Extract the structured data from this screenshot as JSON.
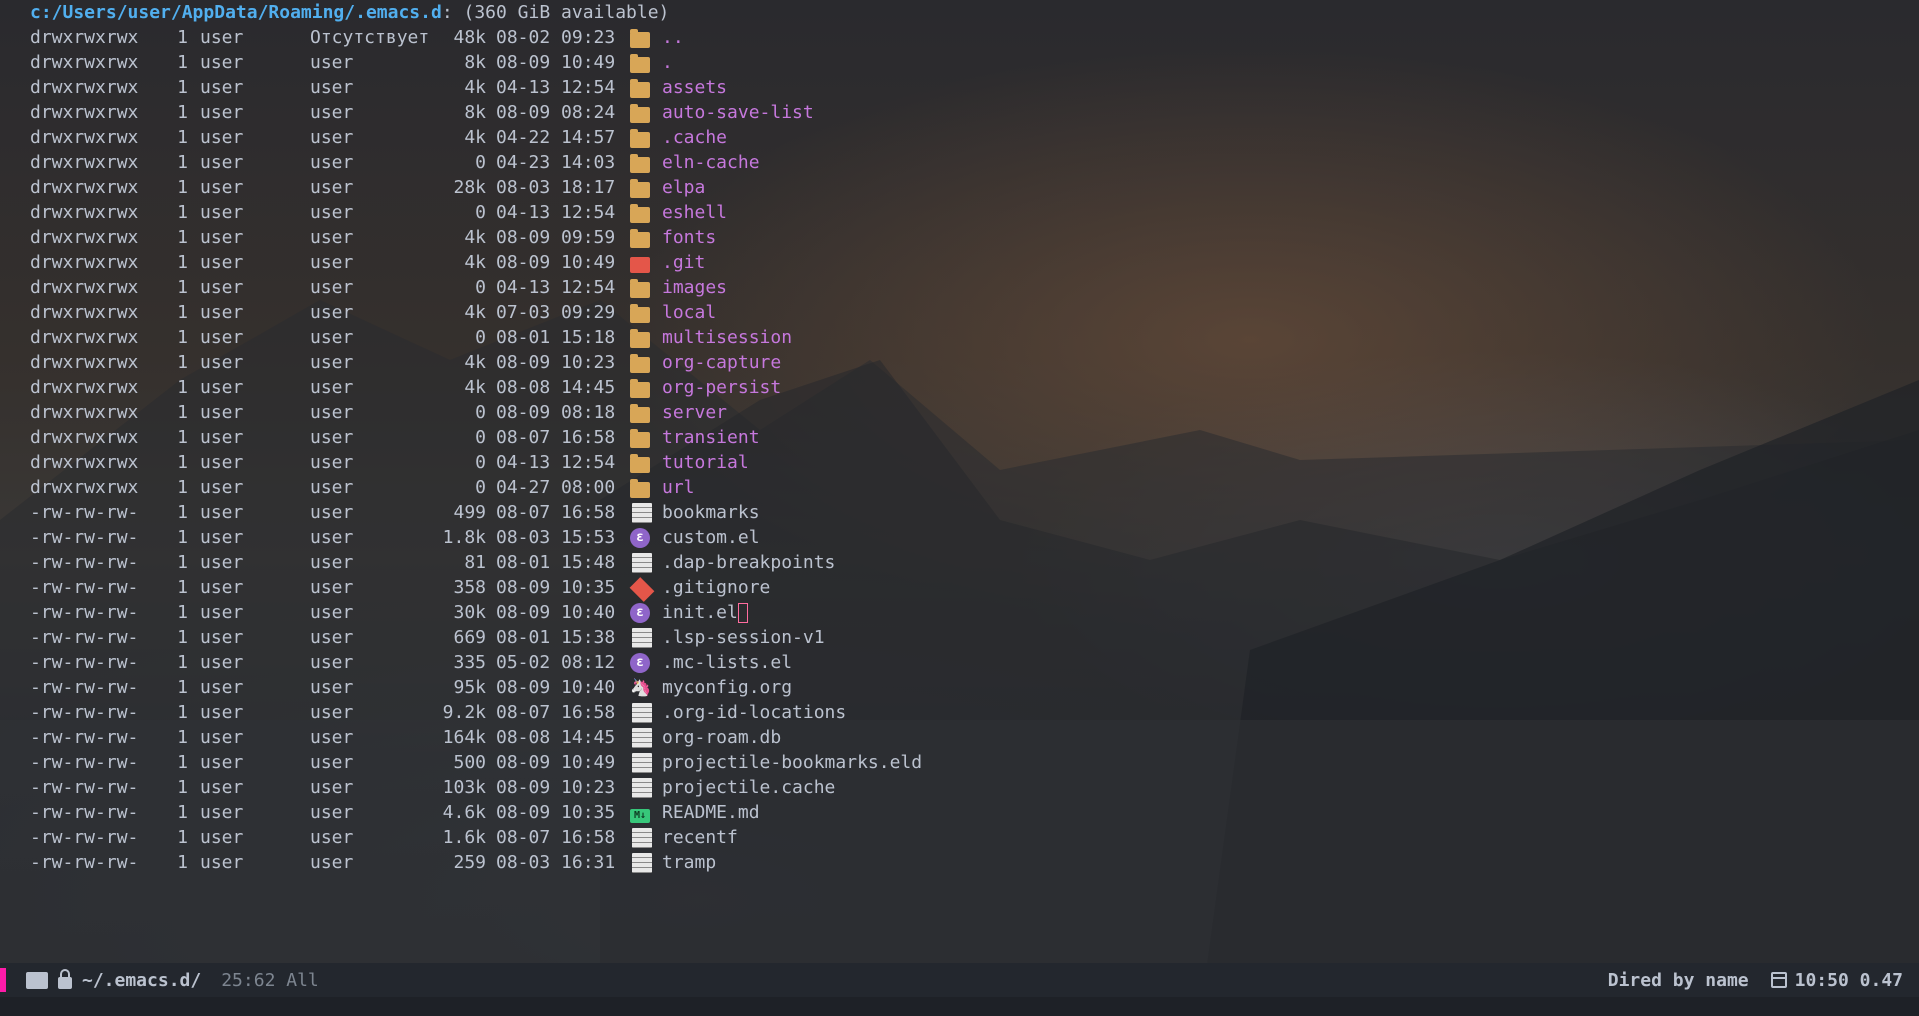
{
  "header": {
    "path": "c:/Users/user/AppData/Roaming/.emacs.d",
    "suffix": ": (360 GiB available)"
  },
  "rows": [
    {
      "perm": "drwxrwxrwx",
      "links": "1",
      "owner": "user",
      "group": "Отсутствует",
      "size": "48k",
      "date": "08-02 09:23",
      "icon": "folder-icon",
      "name": "..",
      "dir": true
    },
    {
      "perm": "drwxrwxrwx",
      "links": "1",
      "owner": "user",
      "group": "user",
      "size": "8k",
      "date": "08-09 10:49",
      "icon": "folder-icon",
      "name": ".",
      "dir": true
    },
    {
      "perm": "drwxrwxrwx",
      "links": "1",
      "owner": "user",
      "group": "user",
      "size": "4k",
      "date": "04-13 12:54",
      "icon": "folder-icon",
      "name": "assets",
      "dir": true
    },
    {
      "perm": "drwxrwxrwx",
      "links": "1",
      "owner": "user",
      "group": "user",
      "size": "8k",
      "date": "08-09 08:24",
      "icon": "folder-icon",
      "name": "auto-save-list",
      "dir": true
    },
    {
      "perm": "drwxrwxrwx",
      "links": "1",
      "owner": "user",
      "group": "user",
      "size": "4k",
      "date": "04-22 14:57",
      "icon": "folder-icon",
      "name": ".cache",
      "dir": true
    },
    {
      "perm": "drwxrwxrwx",
      "links": "1",
      "owner": "user",
      "group": "user",
      "size": "0",
      "date": "04-23 14:03",
      "icon": "folder-icon",
      "name": "eln-cache",
      "dir": true
    },
    {
      "perm": "drwxrwxrwx",
      "links": "1",
      "owner": "user",
      "group": "user",
      "size": "28k",
      "date": "08-03 18:17",
      "icon": "folder-icon",
      "name": "elpa",
      "dir": true
    },
    {
      "perm": "drwxrwxrwx",
      "links": "1",
      "owner": "user",
      "group": "user",
      "size": "0",
      "date": "04-13 12:54",
      "icon": "folder-icon",
      "name": "eshell",
      "dir": true
    },
    {
      "perm": "drwxrwxrwx",
      "links": "1",
      "owner": "user",
      "group": "user",
      "size": "4k",
      "date": "08-09 09:59",
      "icon": "folder-icon",
      "name": "fonts",
      "dir": true
    },
    {
      "perm": "drwxrwxrwx",
      "links": "1",
      "owner": "user",
      "group": "user",
      "size": "4k",
      "date": "08-09 10:49",
      "icon": "git-folder-icon",
      "name": ".git",
      "dir": true
    },
    {
      "perm": "drwxrwxrwx",
      "links": "1",
      "owner": "user",
      "group": "user",
      "size": "0",
      "date": "04-13 12:54",
      "icon": "folder-icon",
      "name": "images",
      "dir": true
    },
    {
      "perm": "drwxrwxrwx",
      "links": "1",
      "owner": "user",
      "group": "user",
      "size": "4k",
      "date": "07-03 09:29",
      "icon": "folder-icon",
      "name": "local",
      "dir": true
    },
    {
      "perm": "drwxrwxrwx",
      "links": "1",
      "owner": "user",
      "group": "user",
      "size": "0",
      "date": "08-01 15:18",
      "icon": "folder-icon",
      "name": "multisession",
      "dir": true
    },
    {
      "perm": "drwxrwxrwx",
      "links": "1",
      "owner": "user",
      "group": "user",
      "size": "4k",
      "date": "08-09 10:23",
      "icon": "folder-icon",
      "name": "org-capture",
      "dir": true
    },
    {
      "perm": "drwxrwxrwx",
      "links": "1",
      "owner": "user",
      "group": "user",
      "size": "4k",
      "date": "08-08 14:45",
      "icon": "folder-icon",
      "name": "org-persist",
      "dir": true
    },
    {
      "perm": "drwxrwxrwx",
      "links": "1",
      "owner": "user",
      "group": "user",
      "size": "0",
      "date": "08-09 08:18",
      "icon": "folder-icon",
      "name": "server",
      "dir": true
    },
    {
      "perm": "drwxrwxrwx",
      "links": "1",
      "owner": "user",
      "group": "user",
      "size": "0",
      "date": "08-07 16:58",
      "icon": "folder-icon",
      "name": "transient",
      "dir": true
    },
    {
      "perm": "drwxrwxrwx",
      "links": "1",
      "owner": "user",
      "group": "user",
      "size": "0",
      "date": "04-13 12:54",
      "icon": "folder-icon",
      "name": "tutorial",
      "dir": true
    },
    {
      "perm": "drwxrwxrwx",
      "links": "1",
      "owner": "user",
      "group": "user",
      "size": "0",
      "date": "04-27 08:00",
      "icon": "folder-icon",
      "name": "url",
      "dir": true
    },
    {
      "perm": "-rw-rw-rw-",
      "links": "1",
      "owner": "user",
      "group": "user",
      "size": "499",
      "date": "08-07 16:58",
      "icon": "file-icon",
      "name": "bookmarks",
      "dir": false
    },
    {
      "perm": "-rw-rw-rw-",
      "links": "1",
      "owner": "user",
      "group": "user",
      "size": "1.8k",
      "date": "08-03 15:53",
      "icon": "emacs-lisp-icon",
      "name": "custom.el",
      "dir": false
    },
    {
      "perm": "-rw-rw-rw-",
      "links": "1",
      "owner": "user",
      "group": "user",
      "size": "81",
      "date": "08-01 15:48",
      "icon": "file-icon",
      "name": ".dap-breakpoints",
      "dir": false
    },
    {
      "perm": "-rw-rw-rw-",
      "links": "1",
      "owner": "user",
      "group": "user",
      "size": "358",
      "date": "08-09 10:35",
      "icon": "git-icon",
      "name": ".gitignore",
      "dir": false
    },
    {
      "perm": "-rw-rw-rw-",
      "links": "1",
      "owner": "user",
      "group": "user",
      "size": "30k",
      "date": "08-09 10:40",
      "icon": "emacs-lisp-icon",
      "name": "init.el",
      "dir": false,
      "cursor": true
    },
    {
      "perm": "-rw-rw-rw-",
      "links": "1",
      "owner": "user",
      "group": "user",
      "size": "669",
      "date": "08-01 15:38",
      "icon": "file-icon",
      "name": ".lsp-session-v1",
      "dir": false
    },
    {
      "perm": "-rw-rw-rw-",
      "links": "1",
      "owner": "user",
      "group": "user",
      "size": "335",
      "date": "05-02 08:12",
      "icon": "emacs-lisp-icon",
      "name": ".mc-lists.el",
      "dir": false
    },
    {
      "perm": "-rw-rw-rw-",
      "links": "1",
      "owner": "user",
      "group": "user",
      "size": "95k",
      "date": "08-09 10:40",
      "icon": "org-unicorn-icon",
      "name": "myconfig.org",
      "dir": false
    },
    {
      "perm": "-rw-rw-rw-",
      "links": "1",
      "owner": "user",
      "group": "user",
      "size": "9.2k",
      "date": "08-07 16:58",
      "icon": "file-icon",
      "name": ".org-id-locations",
      "dir": false
    },
    {
      "perm": "-rw-rw-rw-",
      "links": "1",
      "owner": "user",
      "group": "user",
      "size": "164k",
      "date": "08-08 14:45",
      "icon": "file-icon",
      "name": "org-roam.db",
      "dir": false
    },
    {
      "perm": "-rw-rw-rw-",
      "links": "1",
      "owner": "user",
      "group": "user",
      "size": "500",
      "date": "08-09 10:49",
      "icon": "file-icon",
      "name": "projectile-bookmarks.eld",
      "dir": false
    },
    {
      "perm": "-rw-rw-rw-",
      "links": "1",
      "owner": "user",
      "group": "user",
      "size": "103k",
      "date": "08-09 10:23",
      "icon": "file-icon",
      "name": "projectile.cache",
      "dir": false
    },
    {
      "perm": "-rw-rw-rw-",
      "links": "1",
      "owner": "user",
      "group": "user",
      "size": "4.6k",
      "date": "08-09 10:35",
      "icon": "markdown-icon",
      "name": "README.md",
      "dir": false
    },
    {
      "perm": "-rw-rw-rw-",
      "links": "1",
      "owner": "user",
      "group": "user",
      "size": "1.6k",
      "date": "08-07 16:58",
      "icon": "file-icon",
      "name": "recentf",
      "dir": false
    },
    {
      "perm": "-rw-rw-rw-",
      "links": "1",
      "owner": "user",
      "group": "user",
      "size": "259",
      "date": "08-03 16:31",
      "icon": "file-icon",
      "name": "tramp",
      "dir": false
    }
  ],
  "modeline": {
    "path": "~/.emacs.d/",
    "position": "25:62 All",
    "mode": "Dired by name",
    "time": "10:50 0.47",
    "accent": "#ff1ba9"
  },
  "colors": {
    "dir": "#c678dd",
    "header_path": "#51afef",
    "text": "#bbc2cf"
  }
}
